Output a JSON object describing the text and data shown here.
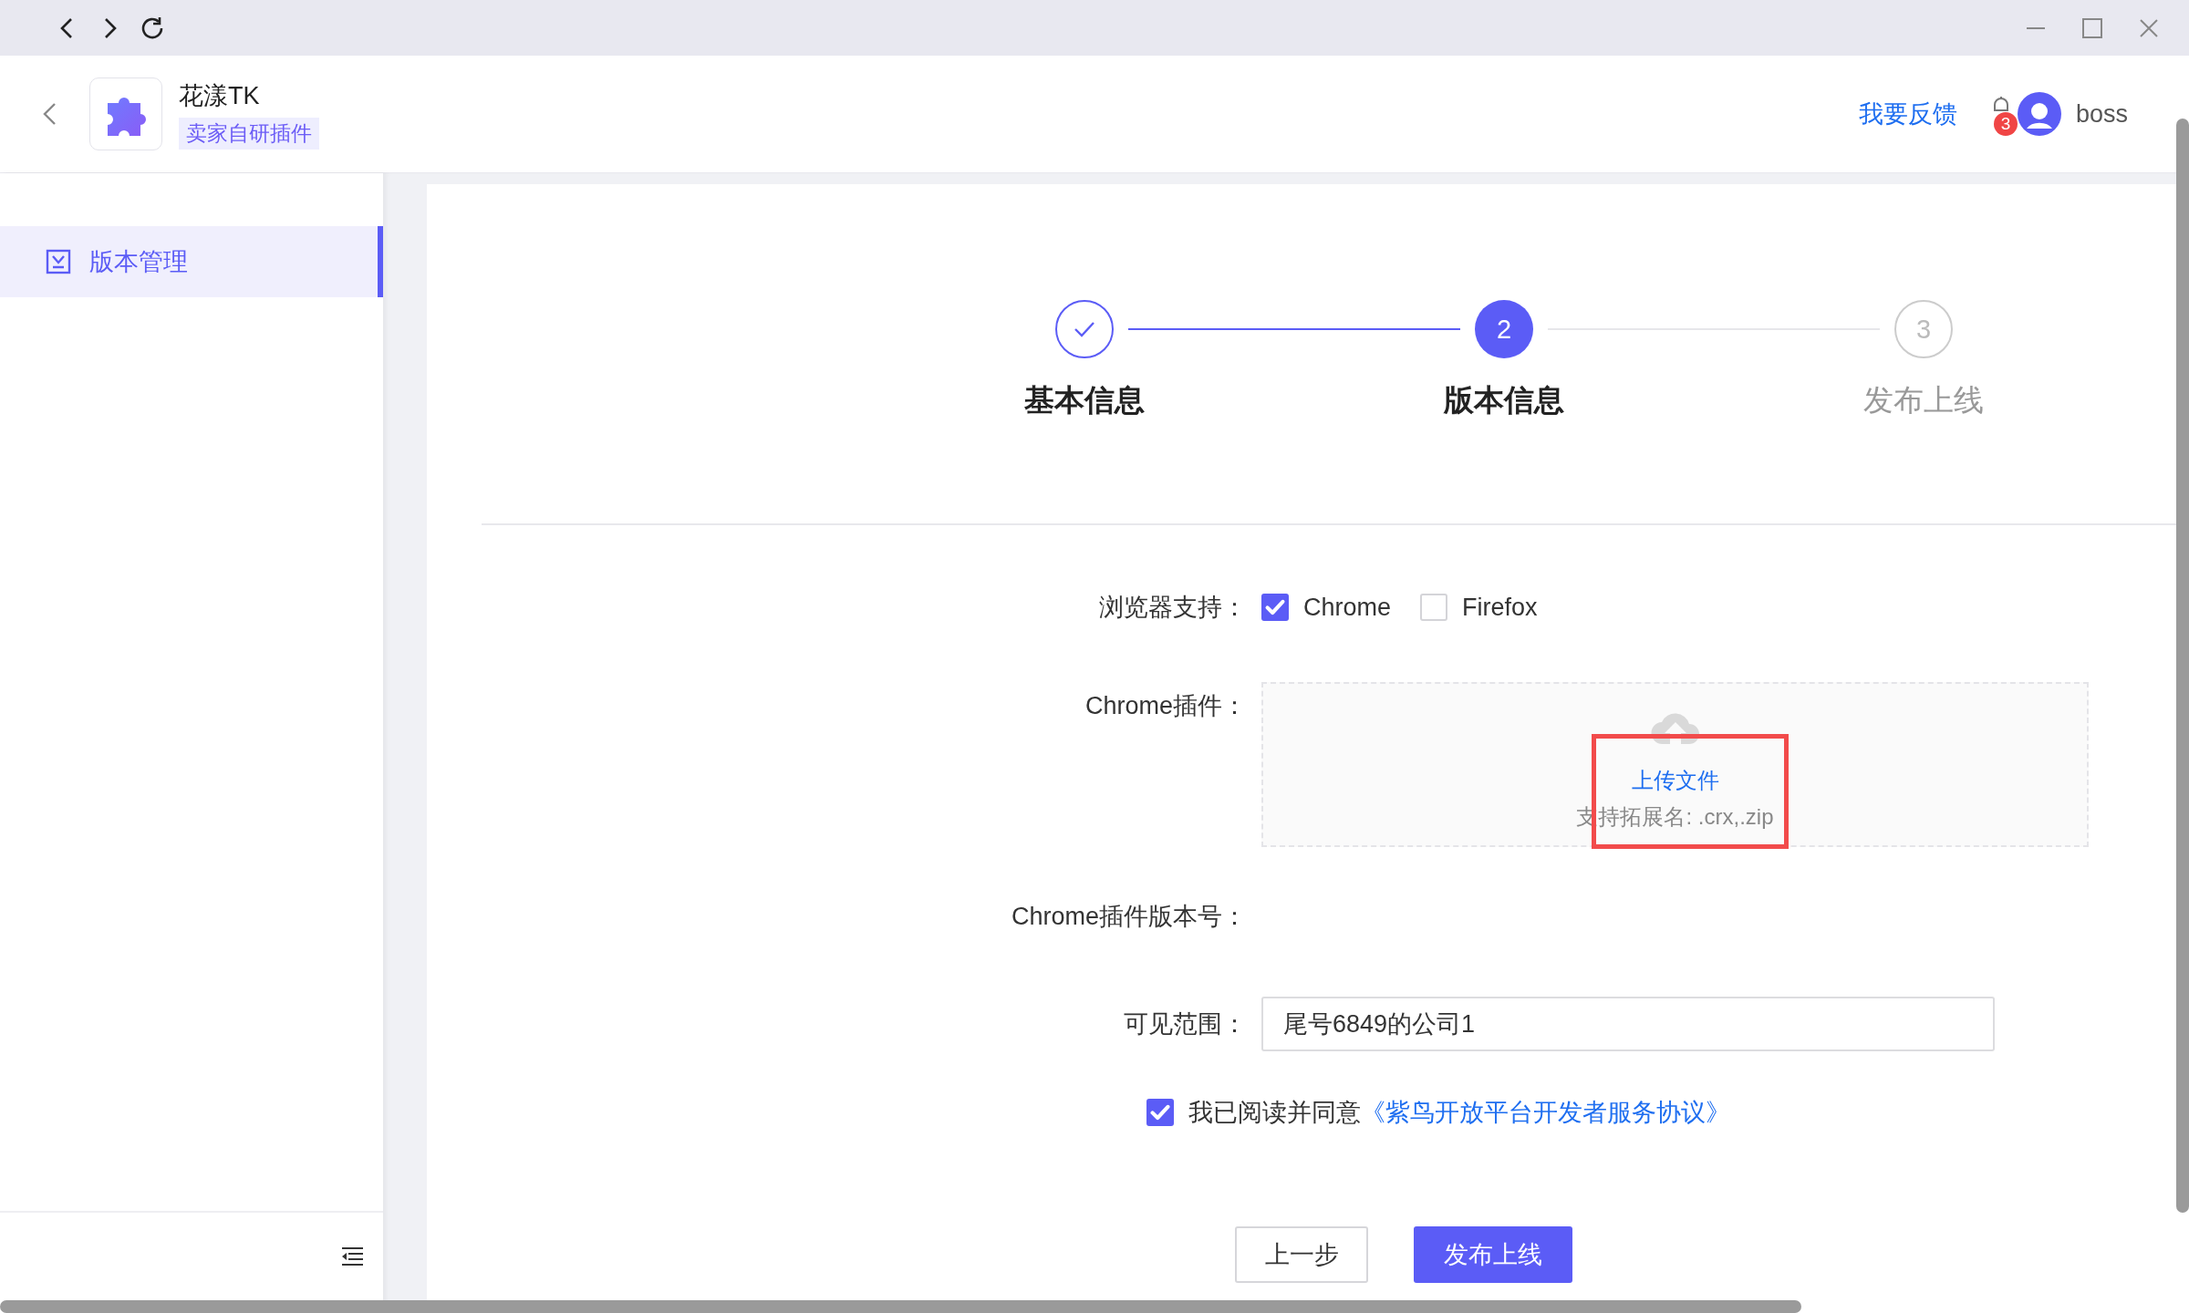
{
  "header": {
    "title": "花漾TK",
    "tag": "卖家自研插件",
    "feedback_link": "我要反馈",
    "notification_count": "3",
    "user": "boss"
  },
  "sidebar": {
    "items": [
      {
        "label": "版本管理",
        "selected": true
      }
    ]
  },
  "steps": [
    {
      "label": "基本信息",
      "completed": true,
      "selected": false
    },
    {
      "number": "2",
      "label": "版本信息",
      "completed": false,
      "selected": true
    },
    {
      "number": "3",
      "label": "发布上线",
      "completed": false,
      "selected": false
    }
  ],
  "form": {
    "browser_support": {
      "label": "浏览器支持：",
      "options": [
        {
          "label": "Chrome",
          "checked": true
        },
        {
          "label": "Firefox",
          "checked": false
        }
      ]
    },
    "plugin_upload": {
      "label": "Chrome插件：",
      "action": "上传文件",
      "hint": "支持拓展名: .crx,.zip"
    },
    "version": {
      "label": "Chrome插件版本号："
    },
    "visibility": {
      "label": "可见范围：",
      "value": "尾号6849的公司1"
    },
    "agreement": {
      "checked": true,
      "text": "我已阅读并同意",
      "link": "《紫鸟开放平台开发者服务协议》"
    }
  },
  "buttons": [
    {
      "label": "上一步",
      "kind": "secondary"
    },
    {
      "label": "发布上线",
      "kind": "primary"
    }
  ]
}
